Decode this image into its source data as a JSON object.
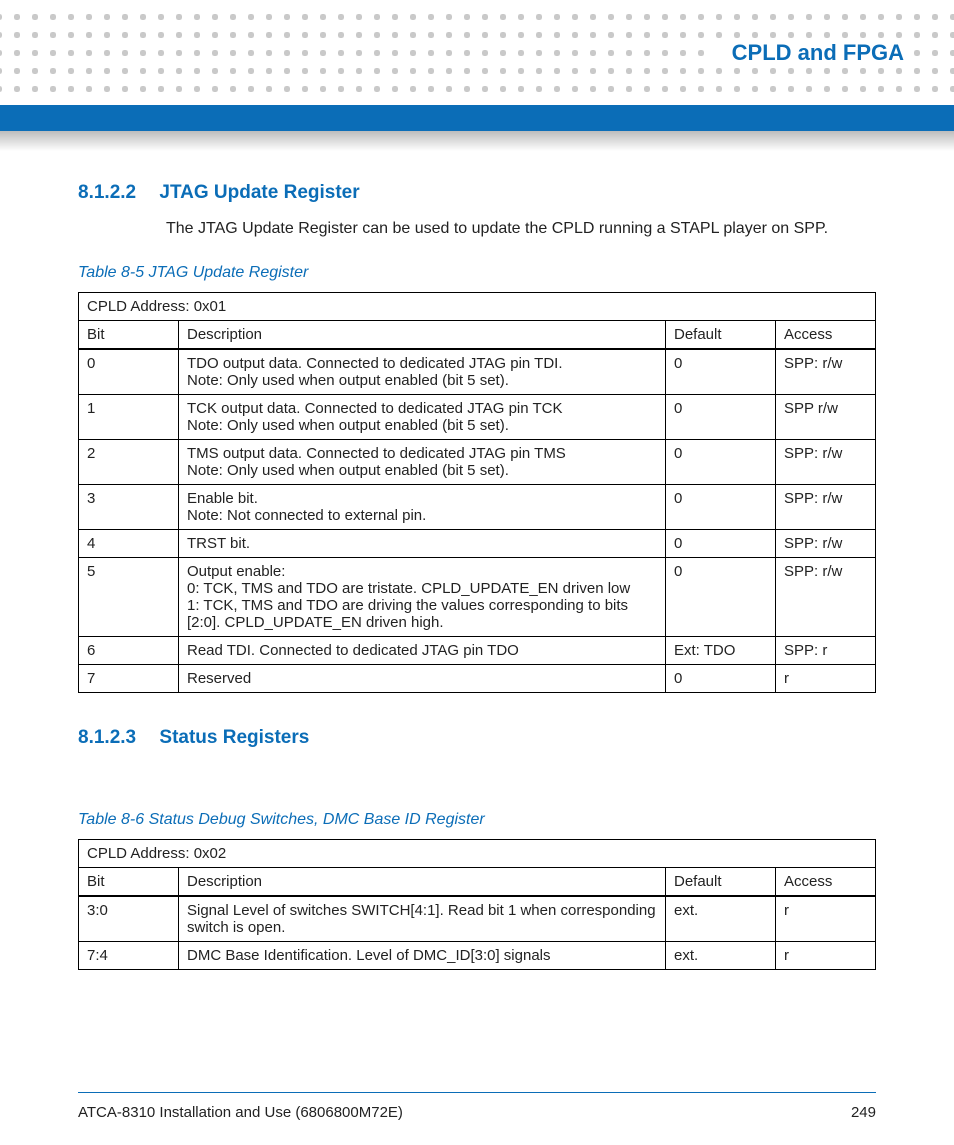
{
  "chapter_title": "CPLD and FPGA",
  "section1": {
    "num": "8.1.2.2",
    "title": "JTAG Update Register",
    "body": "The JTAG Update Register can be used to update the CPLD running a STAPL player on SPP."
  },
  "table1": {
    "caption": "Table 8-5 JTAG Update Register",
    "address": "CPLD Address: 0x01",
    "headers": {
      "bit": "Bit",
      "desc": "Description",
      "def": "Default",
      "acc": "Access"
    },
    "rows": [
      {
        "bit": "0",
        "desc": "TDO output data. Connected to dedicated JTAG pin TDI.\nNote: Only used when output enabled (bit 5 set).",
        "def": "0",
        "acc": "SPP: r/w"
      },
      {
        "bit": "1",
        "desc": "TCK output data. Connected to dedicated JTAG pin TCK\nNote: Only used when output enabled (bit 5 set).",
        "def": "0",
        "acc": "SPP r/w"
      },
      {
        "bit": "2",
        "desc": "TMS output data. Connected to dedicated JTAG pin TMS\nNote: Only used when output enabled (bit 5 set).",
        "def": "0",
        "acc": "SPP: r/w"
      },
      {
        "bit": "3",
        "desc": "Enable bit.\nNote: Not connected to external pin.",
        "def": "0",
        "acc": "SPP: r/w"
      },
      {
        "bit": "4",
        "desc": "TRST bit.",
        "def": "0",
        "acc": "SPP: r/w"
      },
      {
        "bit": "5",
        "desc": "Output enable:\n0: TCK, TMS and TDO are tristate. CPLD_UPDATE_EN driven low\n1: TCK, TMS and TDO are driving the values corresponding to bits [2:0]. CPLD_UPDATE_EN driven high.",
        "def": "0",
        "acc": "SPP: r/w"
      },
      {
        "bit": "6",
        "desc": "Read TDI. Connected to dedicated JTAG pin TDO",
        "def": "Ext: TDO",
        "acc": "SPP: r"
      },
      {
        "bit": "7",
        "desc": "Reserved",
        "def": "0",
        "acc": "r"
      }
    ]
  },
  "section2": {
    "num": "8.1.2.3",
    "title": "Status Registers"
  },
  "table2": {
    "caption": "Table 8-6 Status Debug Switches, DMC Base ID Register",
    "address": "CPLD Address: 0x02",
    "headers": {
      "bit": "Bit",
      "desc": "Description",
      "def": "Default",
      "acc": "Access"
    },
    "rows": [
      {
        "bit": "3:0",
        "desc": "Signal Level of switches SWITCH[4:1]. Read bit 1 when corresponding switch is open.",
        "def": "ext.",
        "acc": "r"
      },
      {
        "bit": "7:4",
        "desc": "DMC Base Identification. Level of DMC_ID[3:0] signals",
        "def": "ext.",
        "acc": "r"
      }
    ]
  },
  "footer": {
    "doc": "ATCA-8310 Installation and Use (6806800M72E)",
    "page": "249"
  }
}
